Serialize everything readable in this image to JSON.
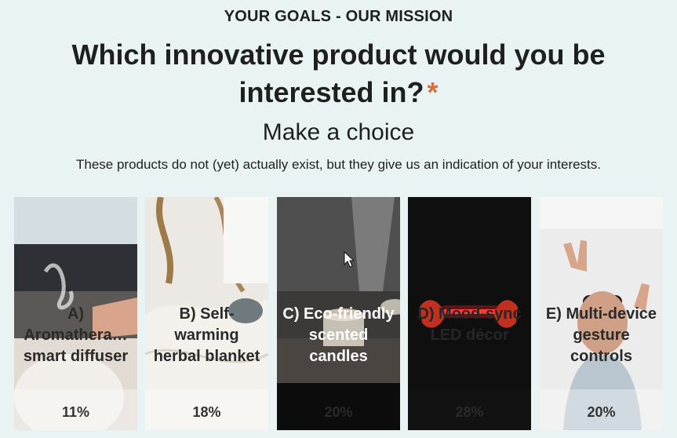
{
  "header": {
    "eyebrow": "YOUR GOALS - OUR MISSION",
    "question": "Which innovative product would you be interested in?",
    "required_mark": "*",
    "subtitle": "Make a choice",
    "description": "These products do not (yet) actually exist, but they give us an indication of your interests."
  },
  "options": [
    {
      "label": "A) Aromathera… smart diffuser",
      "percent": "11%"
    },
    {
      "label": "B) Self-warming herbal blanket",
      "percent": "18%"
    },
    {
      "label": "C) Eco-friendly scented candles",
      "percent": "20%"
    },
    {
      "label": "D) Mood-sync LED décor",
      "percent": "28%"
    },
    {
      "label": "E) Multi-device gesture controls",
      "percent": "20%"
    }
  ],
  "colors": {
    "background": "#eaf3f4",
    "required": "#d8703a",
    "text": "#1f1f1f"
  }
}
